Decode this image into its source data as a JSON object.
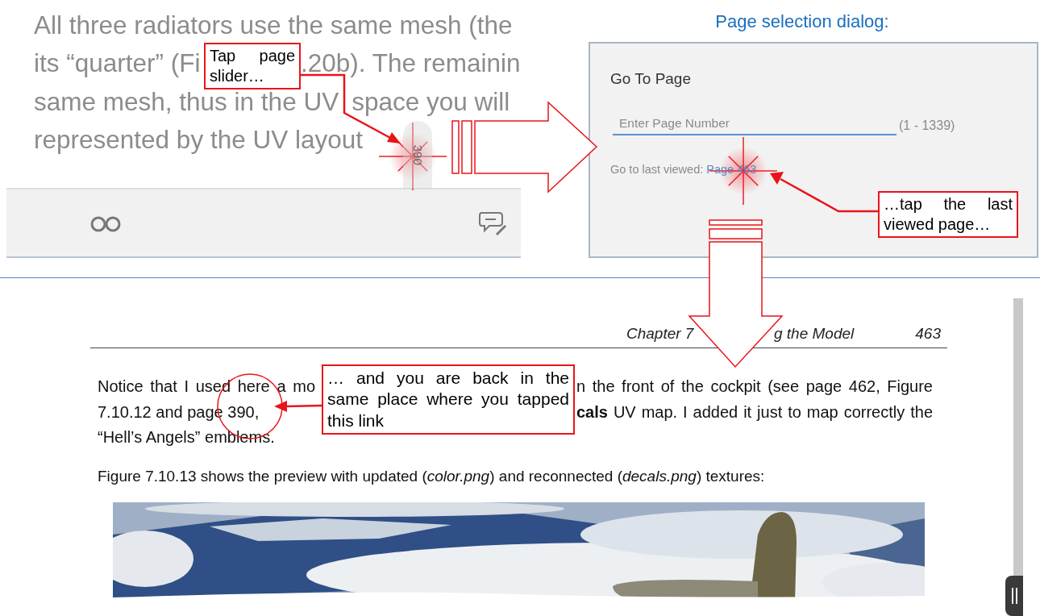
{
  "reader_screen": {
    "lines": [
      [
        "All three radiators use the same mesh (the"
      ],
      [
        "its “quarter” (Fi",
        ".20b). The remainin"
      ],
      [
        "same mesh, thus in the UV",
        "space you will"
      ],
      [
        "represented by the UV layout"
      ]
    ],
    "slider_label": "390"
  },
  "caption": "Page selection dialog:",
  "dialog": {
    "title": "Go To Page",
    "placeholder": "Enter Page Number",
    "range": "(1 - 1339)",
    "last_viewed_label": "Go to last viewed:",
    "last_viewed_link": "Page 463"
  },
  "book_page": {
    "header_left": "Chapter 7",
    "header_right": "g the Model",
    "page_number": "463",
    "paragraph_lines": [
      [
        "Notice that I used here a mo",
        "n the front of the cockpit (see page 462, Figure"
      ],
      [
        "7.10.12 and page 390,",
        "**cals** UV map. I added it just to map correctly the"
      ],
      [
        "“Hell’s Angels” emblems."
      ]
    ],
    "figure_sentence": "Figure 7.10.13 shows the preview with updated (*color.png*) and reconnected (*decals.png*) textures:",
    "figure": {
      "kind": "picture"
    }
  },
  "callouts": [
    {
      "text": "Tap page slider…"
    },
    {
      "text": "…tap the last viewed page…"
    },
    {
      "text": "… and you are back in the same place where you tapped this link"
    }
  ]
}
